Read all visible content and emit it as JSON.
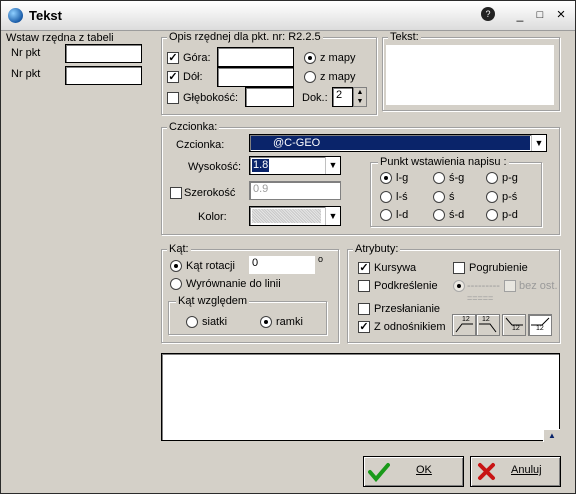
{
  "window": {
    "title": "Tekst",
    "help_icon": "help-icon",
    "minimize": "_",
    "maximize": "□",
    "close": "×"
  },
  "left_panel": {
    "label": "Wstaw rzędna z tabeli",
    "rows": [
      {
        "label": "Nr pkt",
        "value": ""
      },
      {
        "label": "Nr pkt",
        "value": ""
      }
    ]
  },
  "opis": {
    "label": "Opis rzędnej dla pkt. nr: R2.2.5",
    "gora": {
      "label": "Góra:",
      "checked": true,
      "value": "",
      "radio": "z mapy",
      "radio_selected": true
    },
    "dol": {
      "label": "Dół:",
      "checked": true,
      "value": "",
      "radio": "z mapy",
      "radio_selected": false
    },
    "glebokosc": {
      "label": "Głębokość:",
      "checked": false,
      "value": ""
    },
    "dok": {
      "label": "Dok.:",
      "value": "2"
    }
  },
  "tekst": {
    "label": "Tekst:",
    "value": ""
  },
  "czcionka": {
    "group_label": "Czcionka:",
    "font": {
      "label": "Czcionka:",
      "value": "@C-GEO"
    },
    "wysokosc": {
      "label": "Wysokość:",
      "value": "1.8"
    },
    "szerokosc": {
      "label": "Szerokość",
      "checked": false,
      "value": "0.9"
    },
    "kolor": {
      "label": "Kolor:"
    },
    "punkt": {
      "label": "Punkt wstawienia napisu :",
      "options": [
        "l-g",
        "ś-g",
        "p-g",
        "l-ś",
        "ś",
        "p-ś",
        "l-d",
        "ś-d",
        "p-d"
      ],
      "selected": "l-g"
    }
  },
  "kat": {
    "label": "Kąt:",
    "rotacja": {
      "label": "Kąt rotacji",
      "value": "0",
      "unit": "o",
      "selected": true
    },
    "wyrownanie": {
      "label": "Wyrównanie do linii",
      "selected": false
    },
    "wzgledem": {
      "label": "Kąt względem",
      "siatki": "siatki",
      "ramki": "ramki",
      "selected": "ramki"
    }
  },
  "atrybuty": {
    "label": "Atrybuty:",
    "kursywa": {
      "label": "Kursywa",
      "checked": true
    },
    "pogrubienie": {
      "label": "Pogrubienie",
      "checked": false
    },
    "podkreslenie": {
      "label": "Podkreślenie",
      "checked": false
    },
    "bez_ost": {
      "label": "bez ost.",
      "checked": false
    },
    "line_label": "---------",
    "line_label2": "=====",
    "przeslanianie": {
      "label": "Przesłanianie",
      "checked": false
    },
    "odnosnik": {
      "label": "Z odnośnikiem",
      "checked": true
    },
    "align_buttons": [
      {
        "name": "align-bottom-left",
        "label": "12"
      },
      {
        "name": "align-bottom-right",
        "label": "12"
      },
      {
        "name": "align-top-left",
        "label": "12"
      },
      {
        "name": "align-top-right",
        "label": "12"
      }
    ]
  },
  "notes": {
    "value": ""
  },
  "buttons": {
    "ok": "OK",
    "cancel": "Anuluj"
  },
  "colors": {
    "selected_font_bg": "#0a246a",
    "ok_check": "#1a9a1a",
    "cancel_x": "#c81414"
  }
}
